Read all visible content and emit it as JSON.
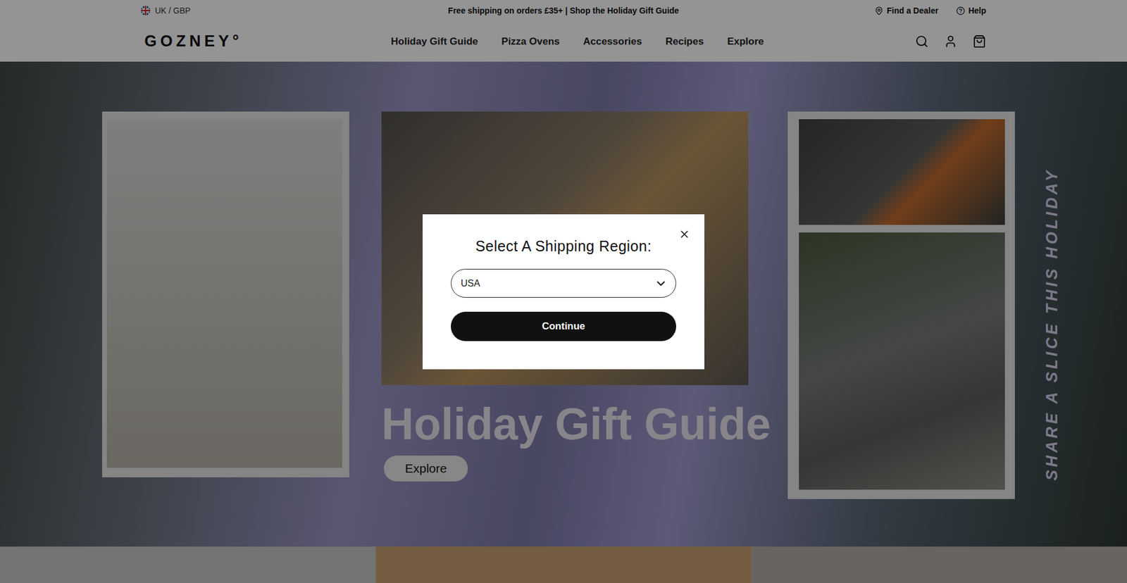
{
  "top_bar": {
    "region": "UK / GBP",
    "announcement": "Free shipping on orders £35+ | Shop the Holiday Gift Guide",
    "links": [
      "Find a Dealer",
      "Help"
    ]
  },
  "header": {
    "logo": "GOZNEY°",
    "nav": [
      "Holiday Gift Guide",
      "Pizza Ovens",
      "Accessories",
      "Recipes",
      "Explore"
    ]
  },
  "hero": {
    "title": "Holiday Gift Guide",
    "button": "Explore",
    "side_text": "SHARE A SLICE THIS HOLIDAY"
  },
  "modal": {
    "title": "Select A Shipping Region:",
    "select_value": "USA",
    "button": "Continue"
  }
}
